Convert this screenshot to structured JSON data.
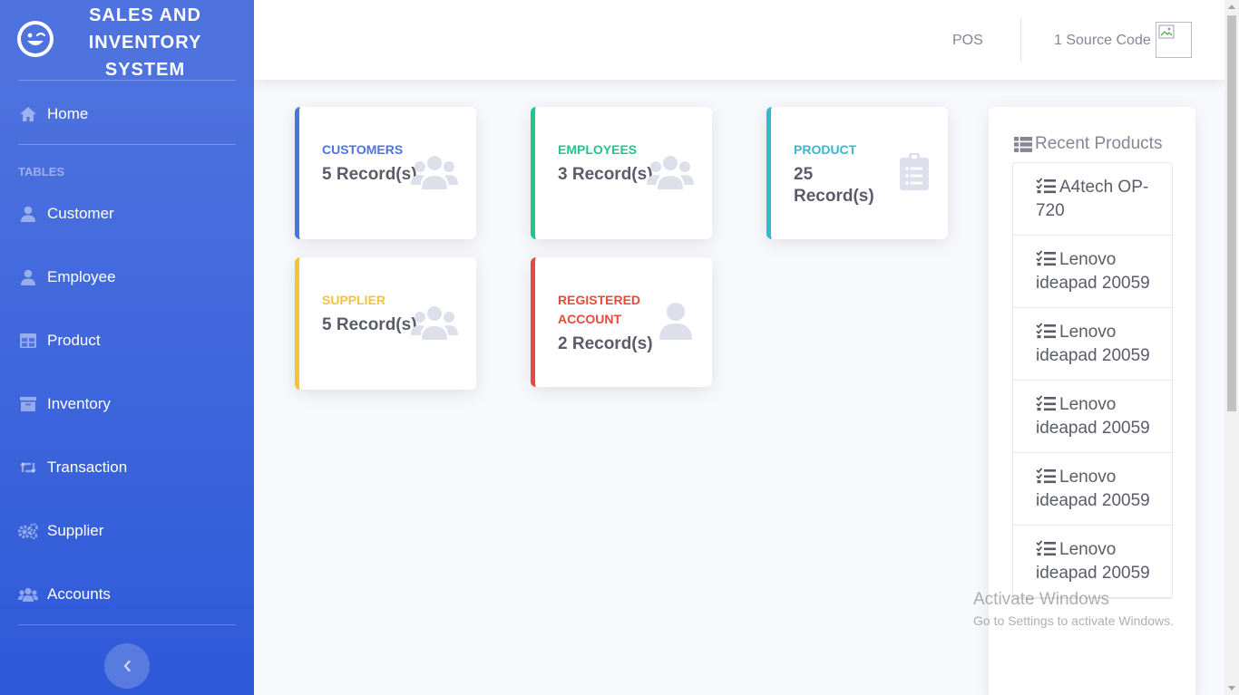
{
  "sidebar": {
    "brand": "SALES AND INVENTORY SYSTEM",
    "home": "Home",
    "heading": "TABLES",
    "items": [
      {
        "label": "Customer",
        "icon": "user-icon"
      },
      {
        "label": "Employee",
        "icon": "user-icon"
      },
      {
        "label": "Product",
        "icon": "table-icon"
      },
      {
        "label": "Inventory",
        "icon": "archive-icon"
      },
      {
        "label": "Transaction",
        "icon": "retweet-icon"
      },
      {
        "label": "Supplier",
        "icon": "cogs-icon"
      },
      {
        "label": "Accounts",
        "icon": "users-icon"
      }
    ]
  },
  "topbar": {
    "pos": "POS",
    "user_name": "1 Source Code"
  },
  "cards": {
    "customers": {
      "title": "Customers",
      "value": "5 Record(s)",
      "color": "#4e73df",
      "icon": "users-icon"
    },
    "employees": {
      "title": "Employees",
      "value": "3 Record(s)",
      "color": "#1cc88a",
      "icon": "users-icon"
    },
    "product": {
      "title": "Product",
      "value": "25 Record(s)",
      "color": "#36b9cc",
      "icon": "clipboard-list-icon"
    },
    "supplier": {
      "title": "Supplier",
      "value": "5 Record(s)",
      "color": "#f6c23e",
      "icon": "users-icon"
    },
    "registered": {
      "title": "Registered Account",
      "value": "2 Record(s)",
      "color": "#e74a3b",
      "icon": "user-icon"
    }
  },
  "recent_products": {
    "title": "Recent Products",
    "items": [
      "A4tech OP-720",
      "Lenovo ideapad 20059",
      "Lenovo ideapad 20059",
      "Lenovo ideapad 20059",
      "Lenovo ideapad 20059",
      "Lenovo ideapad 20059"
    ]
  },
  "watermark": {
    "line1": "Activate Windows",
    "line2": "Go to Settings to activate Windows."
  }
}
